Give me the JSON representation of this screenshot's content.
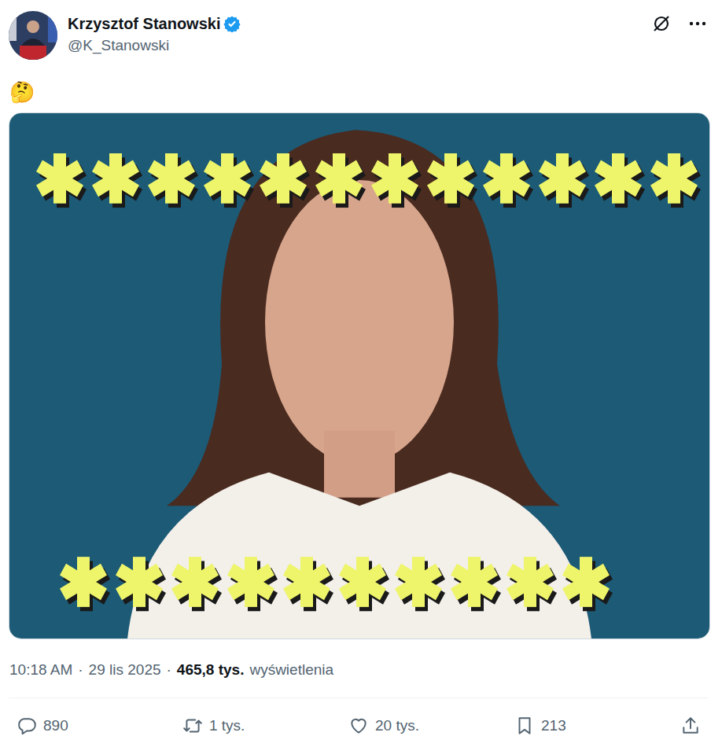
{
  "post": {
    "author": {
      "name": "Krzysztof Stanowski",
      "handle": "@K_Stanowski",
      "verified": true
    },
    "text": "🤔",
    "image": {
      "kind": "photo"
    },
    "meta": {
      "time": "10:18 AM",
      "separator": "·",
      "date": "29 lis 2025",
      "views": "465,8 tys.",
      "views_label": "wyświetlenia"
    }
  },
  "actions": [
    {
      "kind": "reply",
      "count": "890"
    },
    {
      "kind": "repost",
      "count": "1 tys."
    },
    {
      "kind": "like",
      "count": "20 tys."
    },
    {
      "kind": "bookmark",
      "count": "213"
    }
  ]
}
